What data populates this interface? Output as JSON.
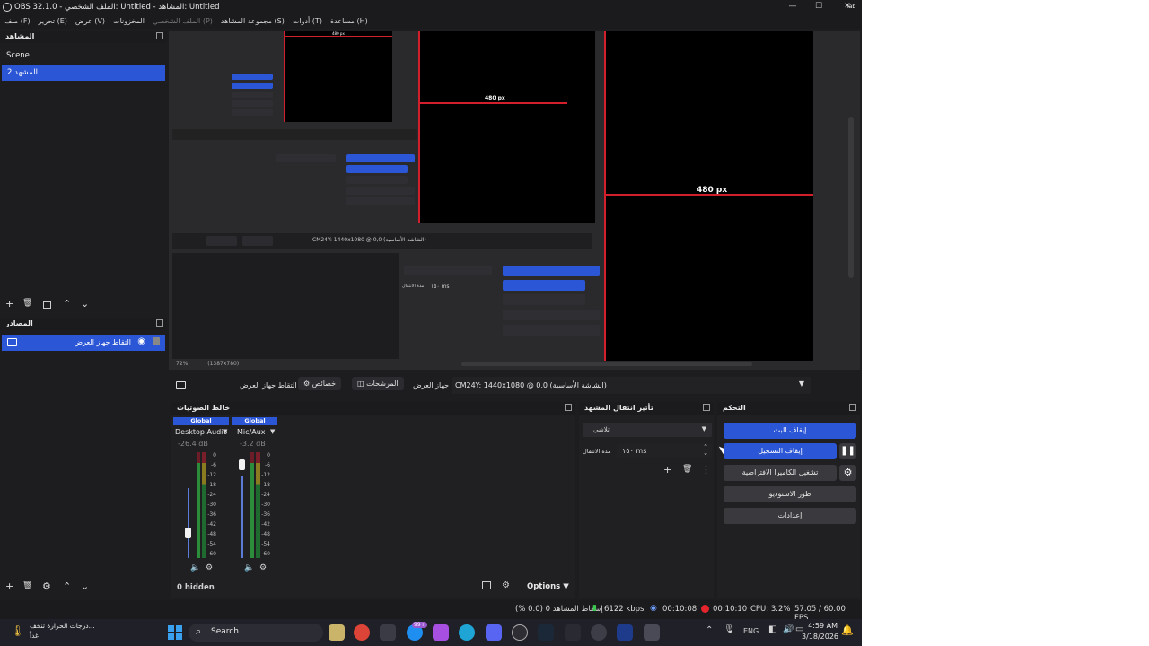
{
  "window": {
    "title": "OBS 32.1.0 - الملف الشخصي: Untitled - المشاهد: Untitled",
    "minimize_glyph": "—",
    "maximize_glyph": "☐",
    "close_glyph": "✕",
    "tab_overlay": "Tab"
  },
  "menu": {
    "items": [
      "ملف (F)",
      "تحرير (E)",
      "عرض (V)",
      "المخزونات",
      "الملف الشخصي (P)",
      "مجموعة المشاهد (S)",
      "أدوات (T)",
      "مساعدة (H)"
    ]
  },
  "scenes": {
    "title": "المشاهد",
    "items": [
      "Scene",
      "المشهد 2"
    ],
    "selected_index": 1
  },
  "sources": {
    "title": "المصادر",
    "items": [
      {
        "label": "التقاط جهاز العرض"
      }
    ]
  },
  "preview": {
    "label_480_a": "480 px",
    "label_480_b": "480 px",
    "label_480_small": "480 px",
    "nested_capture": "CM24Y: 1440x1080 @ 0,0 (الشاشة الأساسية)",
    "nested_zoom": "72%",
    "nested_res": "(1387x780)",
    "nested_ms": "١٥٠ ms",
    "nested_duration": "مدة الانتقال"
  },
  "source_toolbar": {
    "source_name": "التقاط جهاز العرض",
    "properties": "خصائص",
    "filters": "المرشحات",
    "display_label": "جهاز العرض",
    "display_value": "CM24Y: 1440x1080 @ 0,0 (الشاشة الأساسية)"
  },
  "mixer": {
    "title": "خالط الصوتيات",
    "channels": [
      {
        "badge": "Global",
        "name": "Desktop Audio",
        "db": "-26.4 dB",
        "level": 0.15,
        "fader": 0.25
      },
      {
        "badge": "Global",
        "name": "Mic/Aux",
        "db": "-3.2 dB",
        "level": 0.06,
        "fader": 0.88
      }
    ],
    "scale": [
      "0",
      "-6",
      "-12",
      "-18",
      "-24",
      "-30",
      "-36",
      "-42",
      "-48",
      "-54",
      "-60"
    ],
    "hidden": "0 hidden",
    "options": "Options"
  },
  "transitions": {
    "title": "تأثير انتقال المشهد",
    "type": "تلاشي",
    "duration_label": "مدة الانتقال",
    "duration_value": "١٥٠ ms"
  },
  "controls": {
    "title": "التحكم",
    "stop_stream": "إيقاف البث",
    "stop_recording": "إيقاف التسجيل",
    "virtual_camera": "تشغيل الكاميرا الافتراضية",
    "studio_mode": "طور الاستوديو",
    "settings": "إعدادات"
  },
  "status": {
    "dropped": "إسقاط المشاهد 0 (0.0 %)",
    "bitrate": "6122 kbps",
    "stream_time": "00:10:08",
    "rec_time": "00:10:10",
    "cpu": "CPU: 3.2%",
    "fps": "57.05 / 60.00 FPS"
  },
  "taskbar": {
    "weather_line1": "درجات الحرارة تنخف...",
    "weather_line2": "غداً",
    "search": "Search",
    "lang": "ENG",
    "time": "4:59 AM",
    "date": "3/18/2026",
    "badge": "99+"
  },
  "colors": {
    "accent": "#2b56d6",
    "red_guide": "#d21f2b",
    "panel": "#1d1d1f",
    "rec": "#e5242b"
  }
}
